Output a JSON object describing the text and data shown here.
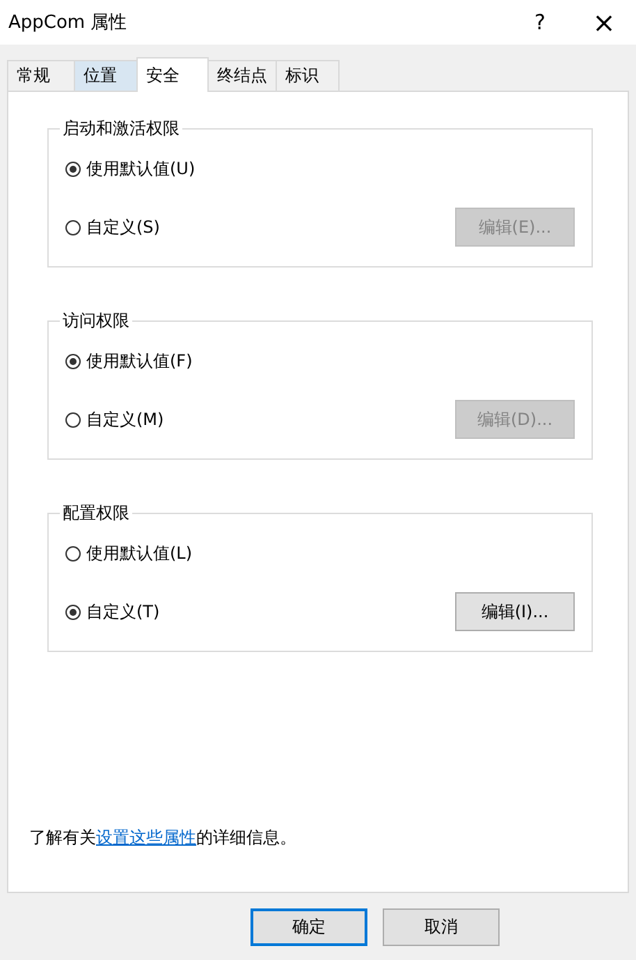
{
  "window": {
    "title": "AppCom 属性",
    "help": "?",
    "close": "×"
  },
  "tabs": [
    {
      "label": "常规",
      "selected": false,
      "hovered": false
    },
    {
      "label": "位置",
      "selected": false,
      "hovered": true
    },
    {
      "label": "安全",
      "selected": true,
      "hovered": false
    },
    {
      "label": "终结点",
      "selected": false,
      "hovered": false
    },
    {
      "label": "标识",
      "selected": false,
      "hovered": false
    }
  ],
  "groups": [
    {
      "title": "启动和激活权限",
      "options": [
        {
          "label": "使用默认值(U)",
          "selected": true
        },
        {
          "label": "自定义(S)",
          "selected": false
        }
      ],
      "button": {
        "label": "编辑(E)...",
        "disabled": true
      }
    },
    {
      "title": "访问权限",
      "options": [
        {
          "label": "使用默认值(F)",
          "selected": true
        },
        {
          "label": "自定义(M)",
          "selected": false
        }
      ],
      "button": {
        "label": "编辑(D)...",
        "disabled": true
      }
    },
    {
      "title": "配置权限",
      "options": [
        {
          "label": "使用默认值(L)",
          "selected": false
        },
        {
          "label": "自定义(T)",
          "selected": true
        }
      ],
      "button": {
        "label": "编辑(I)...",
        "disabled": false
      }
    }
  ],
  "info": {
    "before": "了解有关",
    "link": "设置这些属性",
    "after": "的详细信息。"
  },
  "buttons": [
    {
      "label": "确定",
      "default": true
    },
    {
      "label": "取消",
      "default": false
    }
  ]
}
